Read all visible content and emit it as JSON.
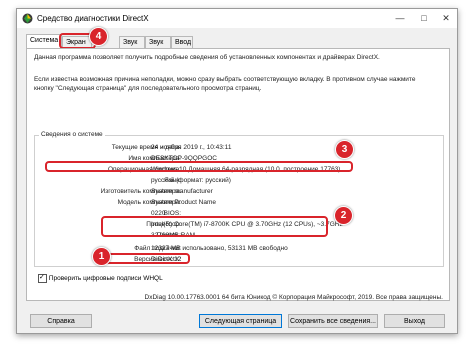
{
  "window": {
    "title": "Средство диагностики DirectX"
  },
  "tabs": [
    "Система",
    "Экран",
    "Звук 2",
    "Звук 3",
    "Ввод"
  ],
  "intro": {
    "line1": "Данная программа позволяет получить подробные сведения об установленных компонентах и драйверах DirectX.",
    "line2": "Если известна возможная причина неполадки, можно сразу выбрать соответствующую вкладку. В противном случае нажмите",
    "line3": "кнопку \"Следующая страница\" для последовательного просмотра страниц."
  },
  "system_info": {
    "title": "Сведения о системе",
    "rows": [
      {
        "label": "Текущие время и дата:",
        "value": "24 ноября 2019 г., 10:43:11"
      },
      {
        "label": "Имя компьютера:",
        "value": "DESKTOP-9QQPGOC"
      },
      {
        "label": "Операционная система:",
        "value": "Windows 10 Домашняя 64-разрядная (10.0, построение 17763)"
      },
      {
        "label": "Язык:",
        "value": "русский (формат: русский)"
      },
      {
        "label": "Изготовитель компьютера:",
        "value": "System manufacturer"
      },
      {
        "label": "Модель компьютера:",
        "value": "System Product Name"
      },
      {
        "label": "BIOS:",
        "value": "0220"
      },
      {
        "label": "Процессор:",
        "value": "Intel(R) Core(TM) i7-8700K CPU @ 3.70GHz (12 CPUs), ~3.7GHz"
      },
      {
        "label": "Память:",
        "value": "32768MB RAM"
      },
      {
        "label": "Файл подкачки:",
        "value": "12327 MB использовано, 53131 MB свободно"
      },
      {
        "label": "Версия DirectX:",
        "value": "DirectX 12"
      }
    ]
  },
  "badges": [
    "1",
    "2",
    "3",
    "4"
  ],
  "whql_checkbox": {
    "label": "Проверить цифровые подписи WHQL",
    "checked": true
  },
  "copyright": "DxDiag 10.00.17763.0001 64 бита Юникод © Корпорация Майкрософт, 2019. Все права защищены.",
  "buttons": {
    "help": "Справка",
    "next": "Следующая страница",
    "save": "Сохранить все сведения...",
    "exit": "Выход"
  },
  "colors": {
    "accent": "#d9242b",
    "window_bg": "#f0f0f0"
  }
}
